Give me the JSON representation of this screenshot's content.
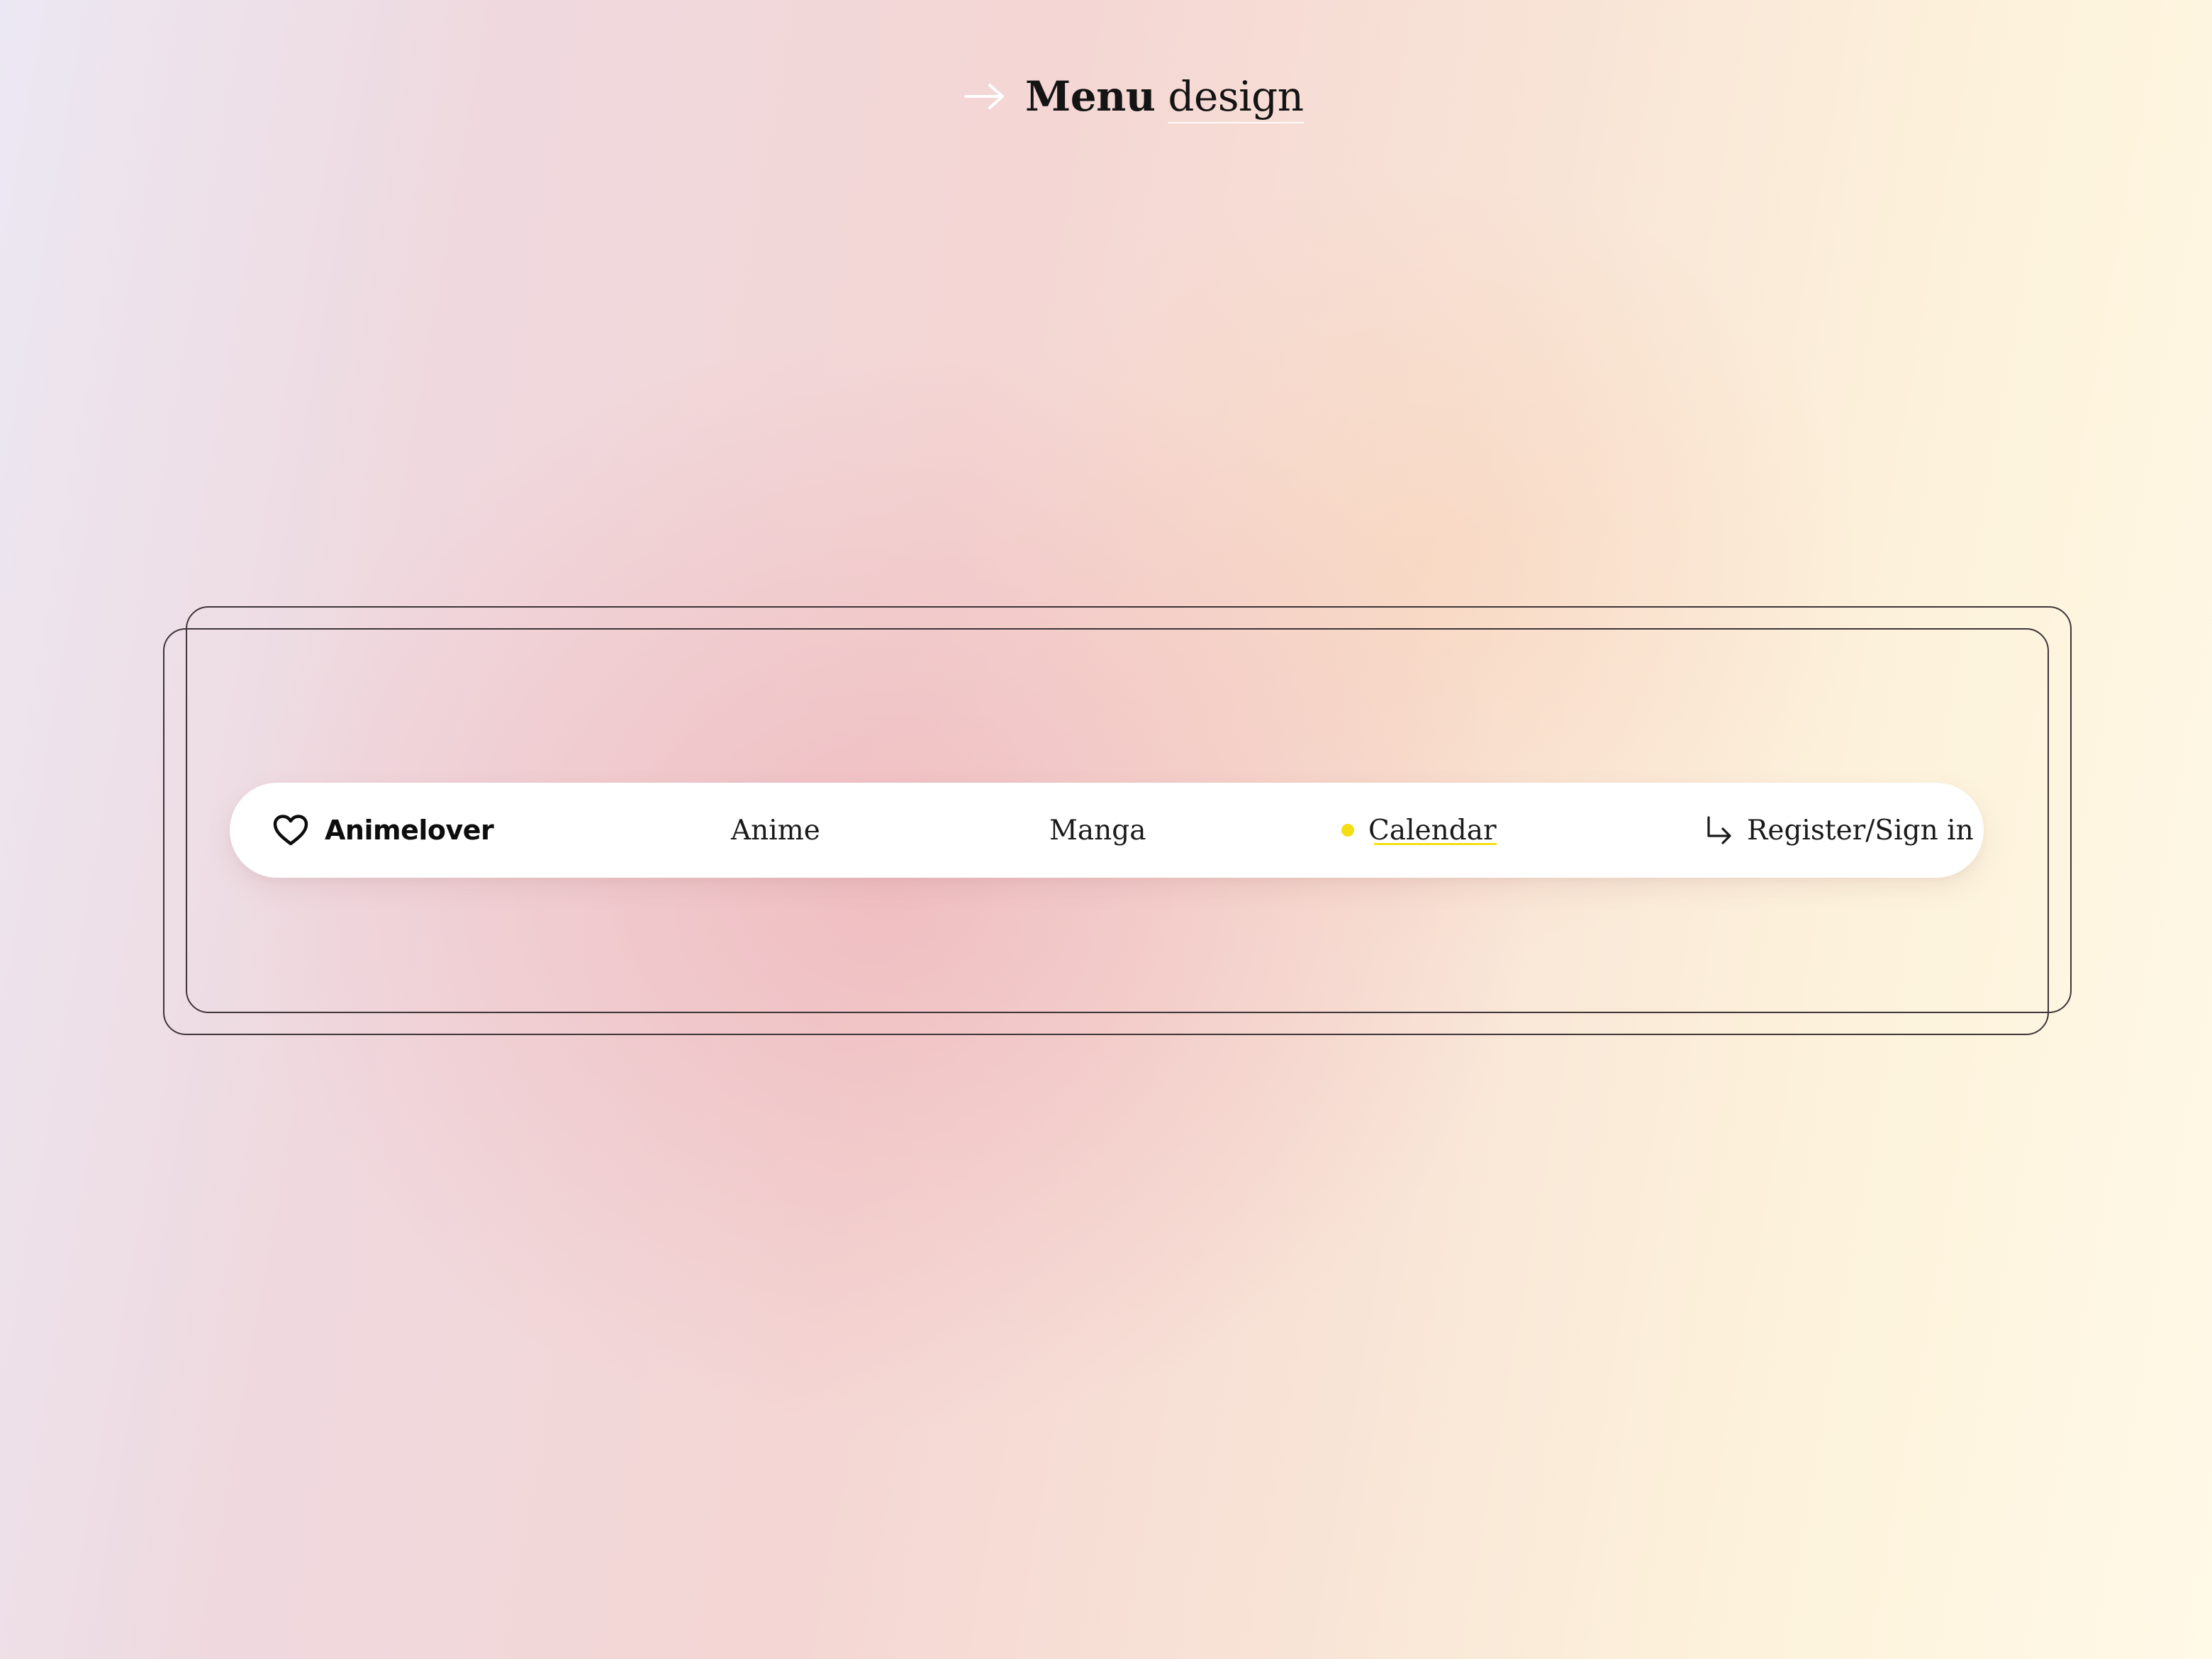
{
  "title": {
    "icon": "arrow-right-icon",
    "bold": "Menu",
    "light": "design"
  },
  "navbar": {
    "brand": {
      "icon": "heart-icon",
      "label": "Animelover"
    },
    "items": [
      {
        "label": "Anime"
      },
      {
        "label": "Manga"
      },
      {
        "label": "Calendar",
        "active": true,
        "indicator": "active-dot"
      },
      {
        "label": "Register/Sign in",
        "icon": "enter-arrow-icon"
      }
    ]
  },
  "colors": {
    "accent": "#F5DD16",
    "text": "#1A1A1A",
    "navbar_bg": "#FFFFFF",
    "frame_stroke": "#3D3538"
  }
}
